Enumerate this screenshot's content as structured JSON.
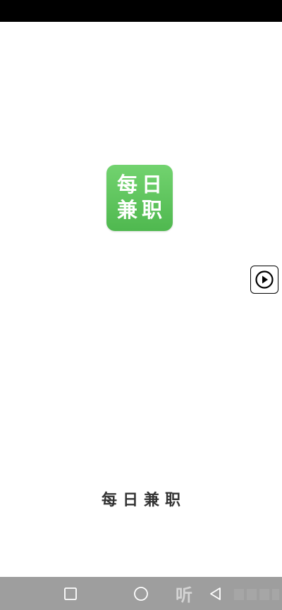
{
  "status_bar": {},
  "logo": {
    "chars": [
      "每",
      "日",
      "兼",
      "职"
    ]
  },
  "app_name": "每日兼职",
  "nav_bar": {
    "listen_glyph": "听"
  },
  "colors": {
    "logo_green_top": "#72d36f",
    "logo_green_bottom": "#4fb84f",
    "nav_bar_bg": "#9e9e9e"
  }
}
